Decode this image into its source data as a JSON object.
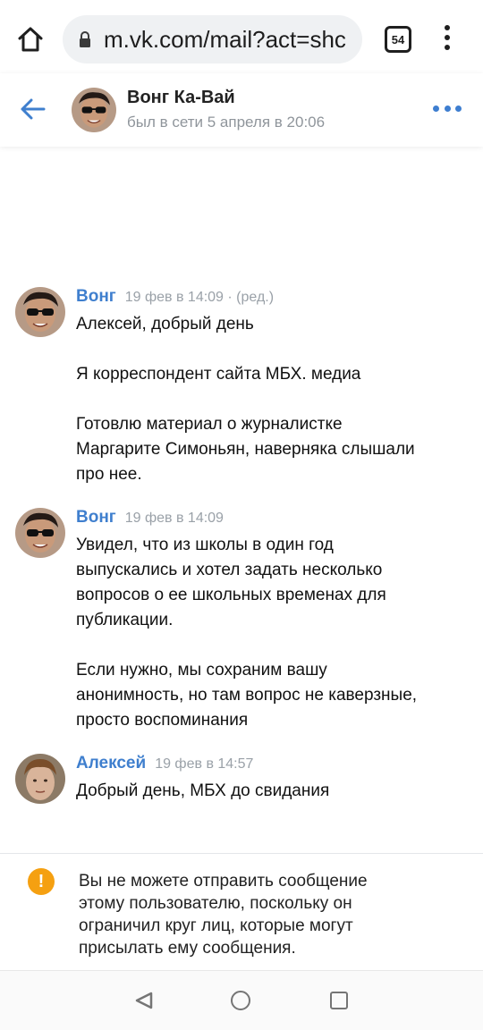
{
  "browser": {
    "url": "m.vk.com/mail?act=shc",
    "tab_count": "54",
    "icons": [
      "home-icon",
      "lock-icon",
      "more-vert-icon"
    ]
  },
  "header": {
    "name": "Вонг Ка-Вай",
    "status": "был в сети 5 апреля в 20:06",
    "icons": [
      "back-arrow-icon",
      "more-horizontal-icon"
    ]
  },
  "messages": [
    {
      "author": "Вонг",
      "time": "19 фев в 14:09",
      "edited": " · (ред.)",
      "lines": [
        "Алексей, добрый день",
        "",
        "Я корреспондент сайта МБХ. медиа",
        "",
        "Готовлю материал о журналистке",
        "Маргарите Симоньян, наверняка слышали",
        "про нее."
      ]
    },
    {
      "author": "Вонг",
      "time": "19 фев в 14:09",
      "lines": [
        "Увидел, что из школы в один год",
        "выпускались и хотел задать несколько",
        "вопросов о ее школьных временах для",
        "публикации.",
        "",
        "Если нужно, мы сохраним вашу",
        "анонимность, но там вопрос не каверзные,",
        "просто воспоминания"
      ]
    },
    {
      "author": "Алексей",
      "time": "19 фев в 14:57",
      "lines": [
        "Добрый день, МБХ до свидания"
      ]
    }
  ],
  "notice": {
    "icon": "!",
    "lines": [
      "Вы не можете отправить сообщение",
      "этому пользователю, поскольку он",
      "ограничил круг лиц, которые могут",
      "присылать ему сообщения."
    ]
  },
  "colors": {
    "accent": "#3f7fce",
    "warning": "#f5a011",
    "meta_gray": "#9aa1a8"
  }
}
